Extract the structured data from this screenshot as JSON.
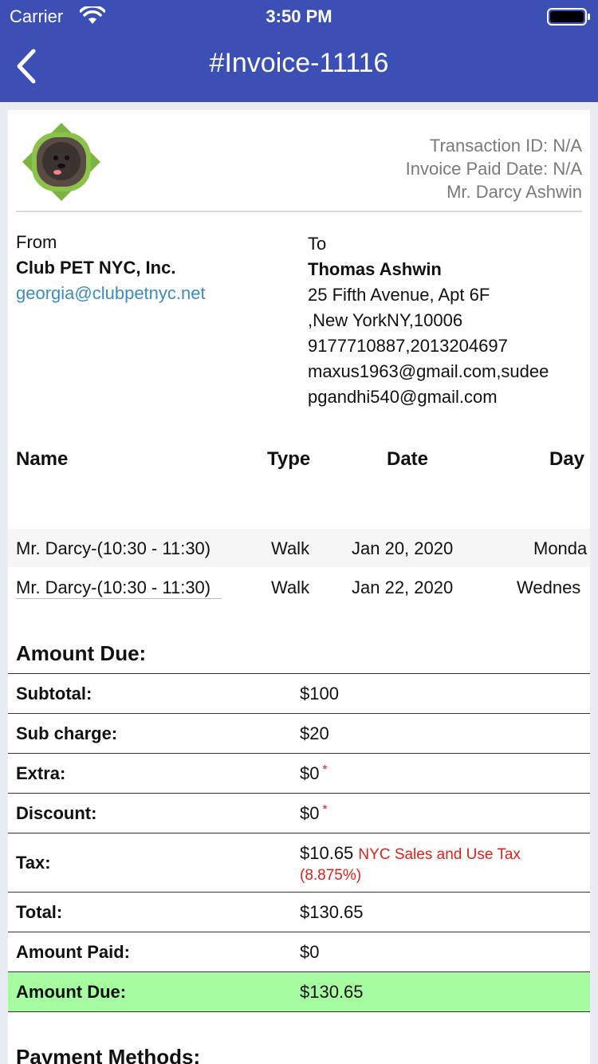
{
  "status": {
    "carrier": "Carrier",
    "time": "3:50 PM"
  },
  "nav": {
    "title": "#Invoice-11116"
  },
  "header": {
    "transaction_id": "Transaction ID: N/A",
    "paid_date": "Invoice Paid Date: N/A",
    "pet": "Mr. Darcy Ashwin"
  },
  "from": {
    "label": "From",
    "company": "Club PET NYC, Inc.",
    "email": "georgia@clubpetnyc.net"
  },
  "to": {
    "label": "To",
    "name": "Thomas Ashwin",
    "lines": [
      "25 Fifth Avenue, Apt 6F",
      ",New YorkNY,10006",
      "9177710887,2013204697",
      "maxus1963@gmail.com,sudee",
      "pgandhi540@gmail.com"
    ]
  },
  "services": {
    "headers": [
      "Name",
      "Type",
      "Date",
      "Day"
    ],
    "rows": [
      {
        "name": "Mr. Darcy-(10:30 - 11:30)",
        "type": "Walk",
        "date": "Jan 20, 2020",
        "day": "Monda"
      },
      {
        "name": "Mr. Darcy-(10:30 - 11:30)",
        "type": "Walk",
        "date": "Jan 22, 2020",
        "day": "Wednes"
      }
    ]
  },
  "amount": {
    "title": "Amount Due:",
    "rows": [
      {
        "key": "Subtotal:",
        "value": "$100"
      },
      {
        "key": "Sub charge:",
        "value": "$20"
      },
      {
        "key": "Extra:",
        "value": "$0",
        "mark": "*"
      },
      {
        "key": "Discount:",
        "value": "$0",
        "mark": "*"
      },
      {
        "key": "Tax:",
        "value": "$10.65",
        "note": "NYC Sales and Use Tax (8.875%)"
      },
      {
        "key": "Total:",
        "value": "$130.65"
      },
      {
        "key": "Amount Paid:",
        "value": "$0"
      },
      {
        "key": "Amount Due:",
        "value": "$130.65"
      }
    ]
  },
  "payment": {
    "title": "Payment Methods:"
  },
  "colors": {
    "nav": "#3c4fb5",
    "due_highlight": "#a6fca0",
    "link": "#3a8dc4",
    "note": "#e0201a"
  }
}
